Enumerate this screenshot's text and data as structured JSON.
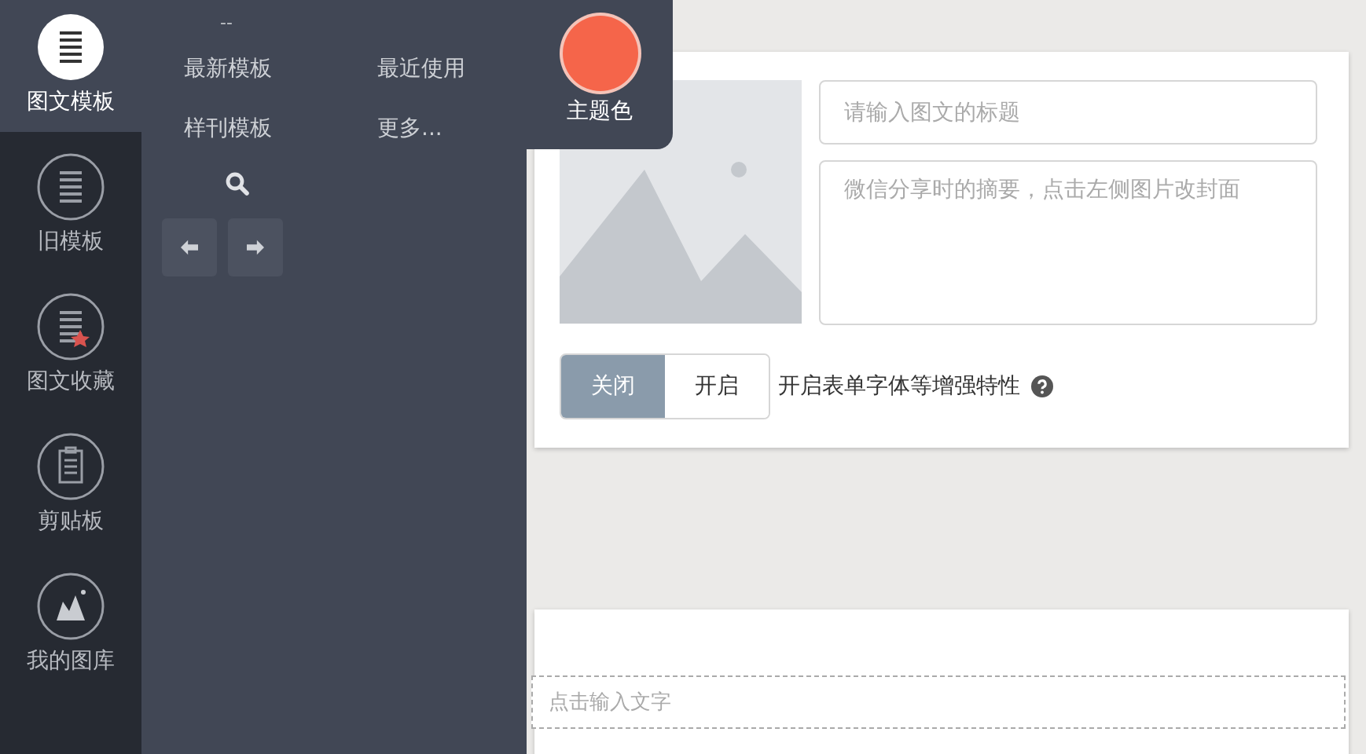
{
  "sidebar": {
    "items": [
      {
        "label": "图文模板",
        "selected": true
      },
      {
        "label": "旧模板",
        "selected": false
      },
      {
        "label": "图文收藏",
        "selected": false
      },
      {
        "label": "剪贴板",
        "selected": false
      },
      {
        "label": "我的图库",
        "selected": false
      }
    ]
  },
  "panel": {
    "handle": "--",
    "links": [
      "最新模板",
      "最近使用",
      "样刊模板",
      "更多..."
    ]
  },
  "theme_color": {
    "label": "主题色",
    "color": "#f5654a"
  },
  "cover": {
    "title_placeholder": "请输入图文的标题",
    "summary_placeholder": "微信分享时的摘要，点击左侧图片改封面"
  },
  "enhance": {
    "options": [
      {
        "label": "关闭",
        "selected": true
      },
      {
        "label": "开启",
        "selected": false
      }
    ],
    "label": "开启表单字体等增强特性"
  },
  "editor": {
    "placeholder": "点击输入文字"
  }
}
